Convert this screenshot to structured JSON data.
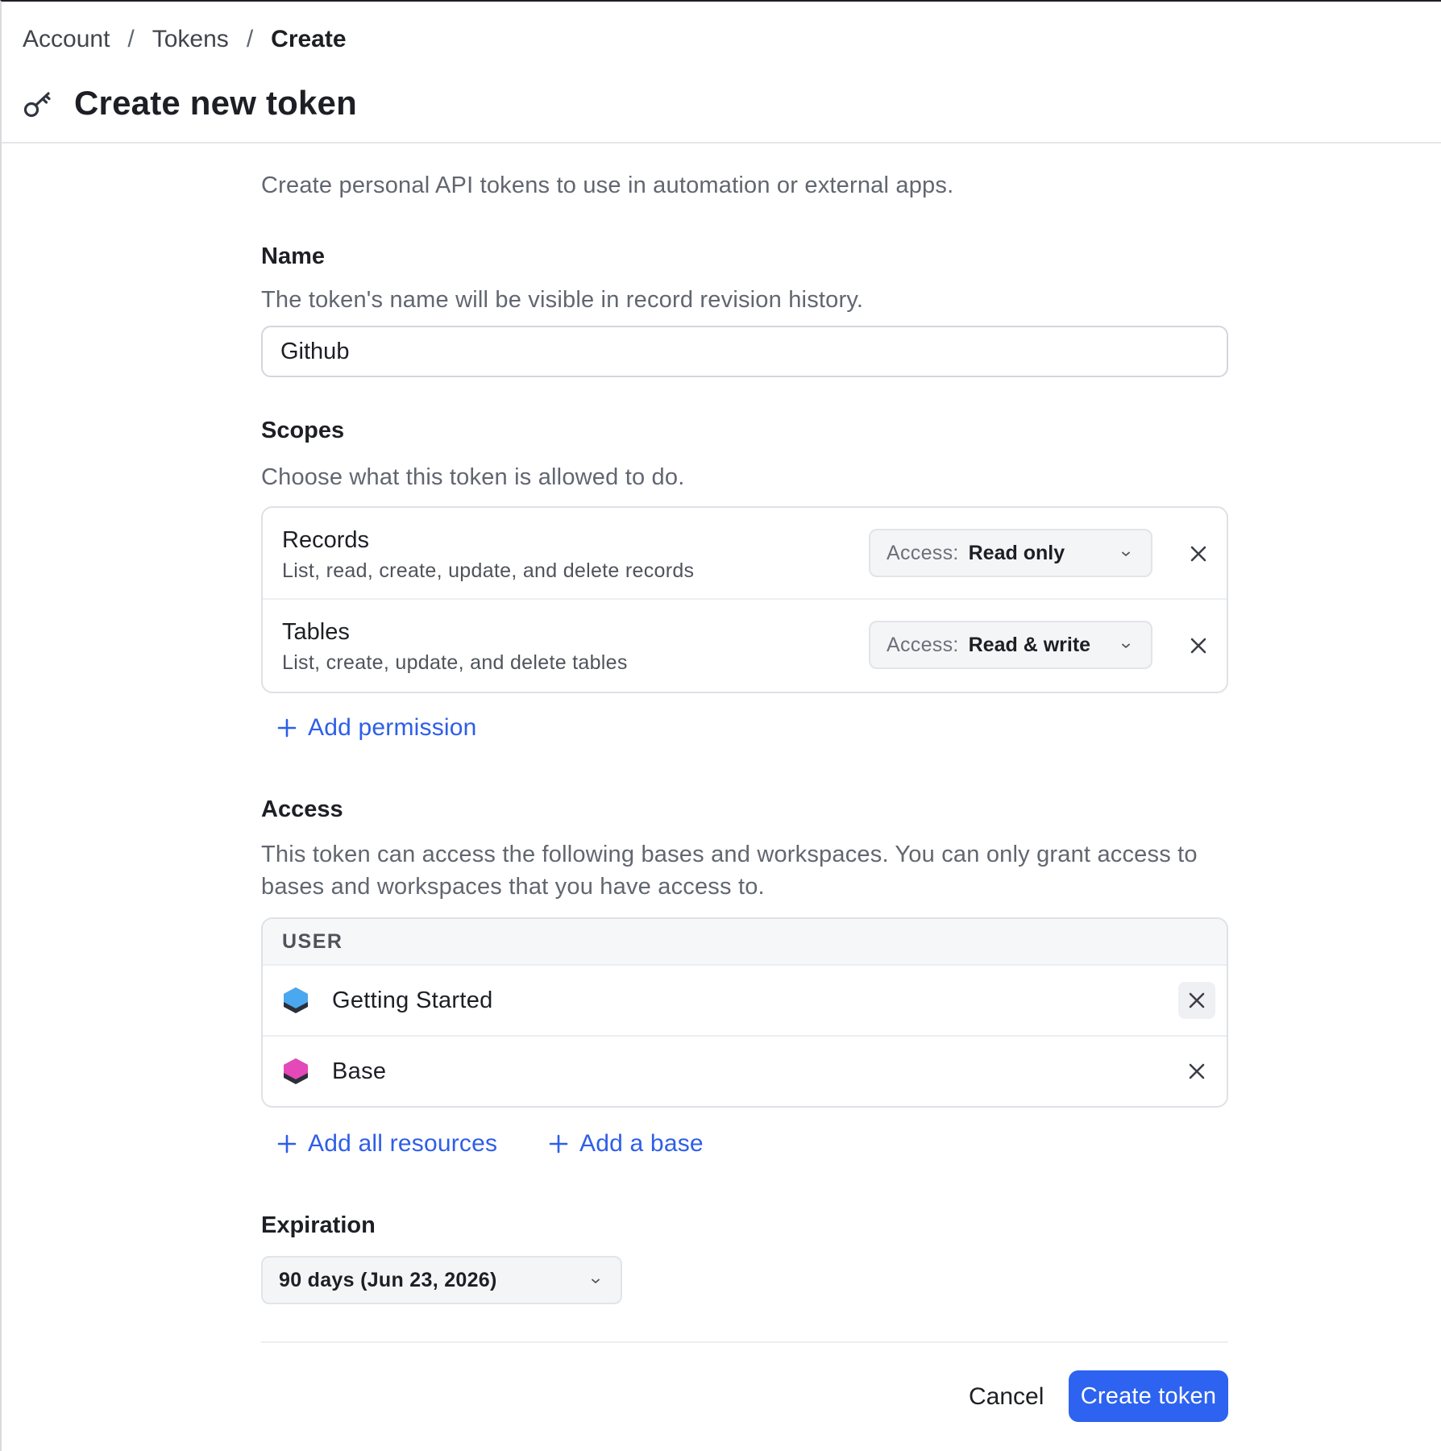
{
  "breadcrumb": {
    "items": [
      "Account",
      "Tokens"
    ],
    "separator": "/",
    "current": "Create"
  },
  "page": {
    "title": "Create new token",
    "icon": "key-icon",
    "intro": "Create personal API tokens to use in automation or external apps."
  },
  "name_section": {
    "title": "Name",
    "description": "The token's name will be visible in record revision history.",
    "value": "Github",
    "placeholder": ""
  },
  "scopes_section": {
    "title": "Scopes",
    "description": "Choose what this token is allowed to do.",
    "scopes": [
      {
        "name": "Records",
        "description": "List, read, create, update, and delete records",
        "access_prefix": "Access:",
        "access_value": "Read only"
      },
      {
        "name": "Tables",
        "description": "List, create, update, and delete tables",
        "access_prefix": "Access:",
        "access_value": "Read & write"
      }
    ],
    "add_label": "Add permission"
  },
  "access_section": {
    "title": "Access",
    "description": "This token can access the following bases and workspaces. You can only grant access to bases and workspaces that you have access to.",
    "group_label": "USER",
    "bases": [
      {
        "name": "Getting Started",
        "color": "#4aa8f0"
      },
      {
        "name": "Base",
        "color": "#e548b8"
      }
    ],
    "add_all_label": "Add all resources",
    "add_base_label": "Add a base"
  },
  "expiration_section": {
    "title": "Expiration",
    "value": "90 days (Jun 23, 2026)"
  },
  "footer": {
    "cancel_label": "Cancel",
    "create_label": "Create token"
  },
  "colors": {
    "accent": "#2d63f0",
    "link": "#2e5ee8",
    "text": "#1d1f25",
    "muted": "#616670"
  }
}
